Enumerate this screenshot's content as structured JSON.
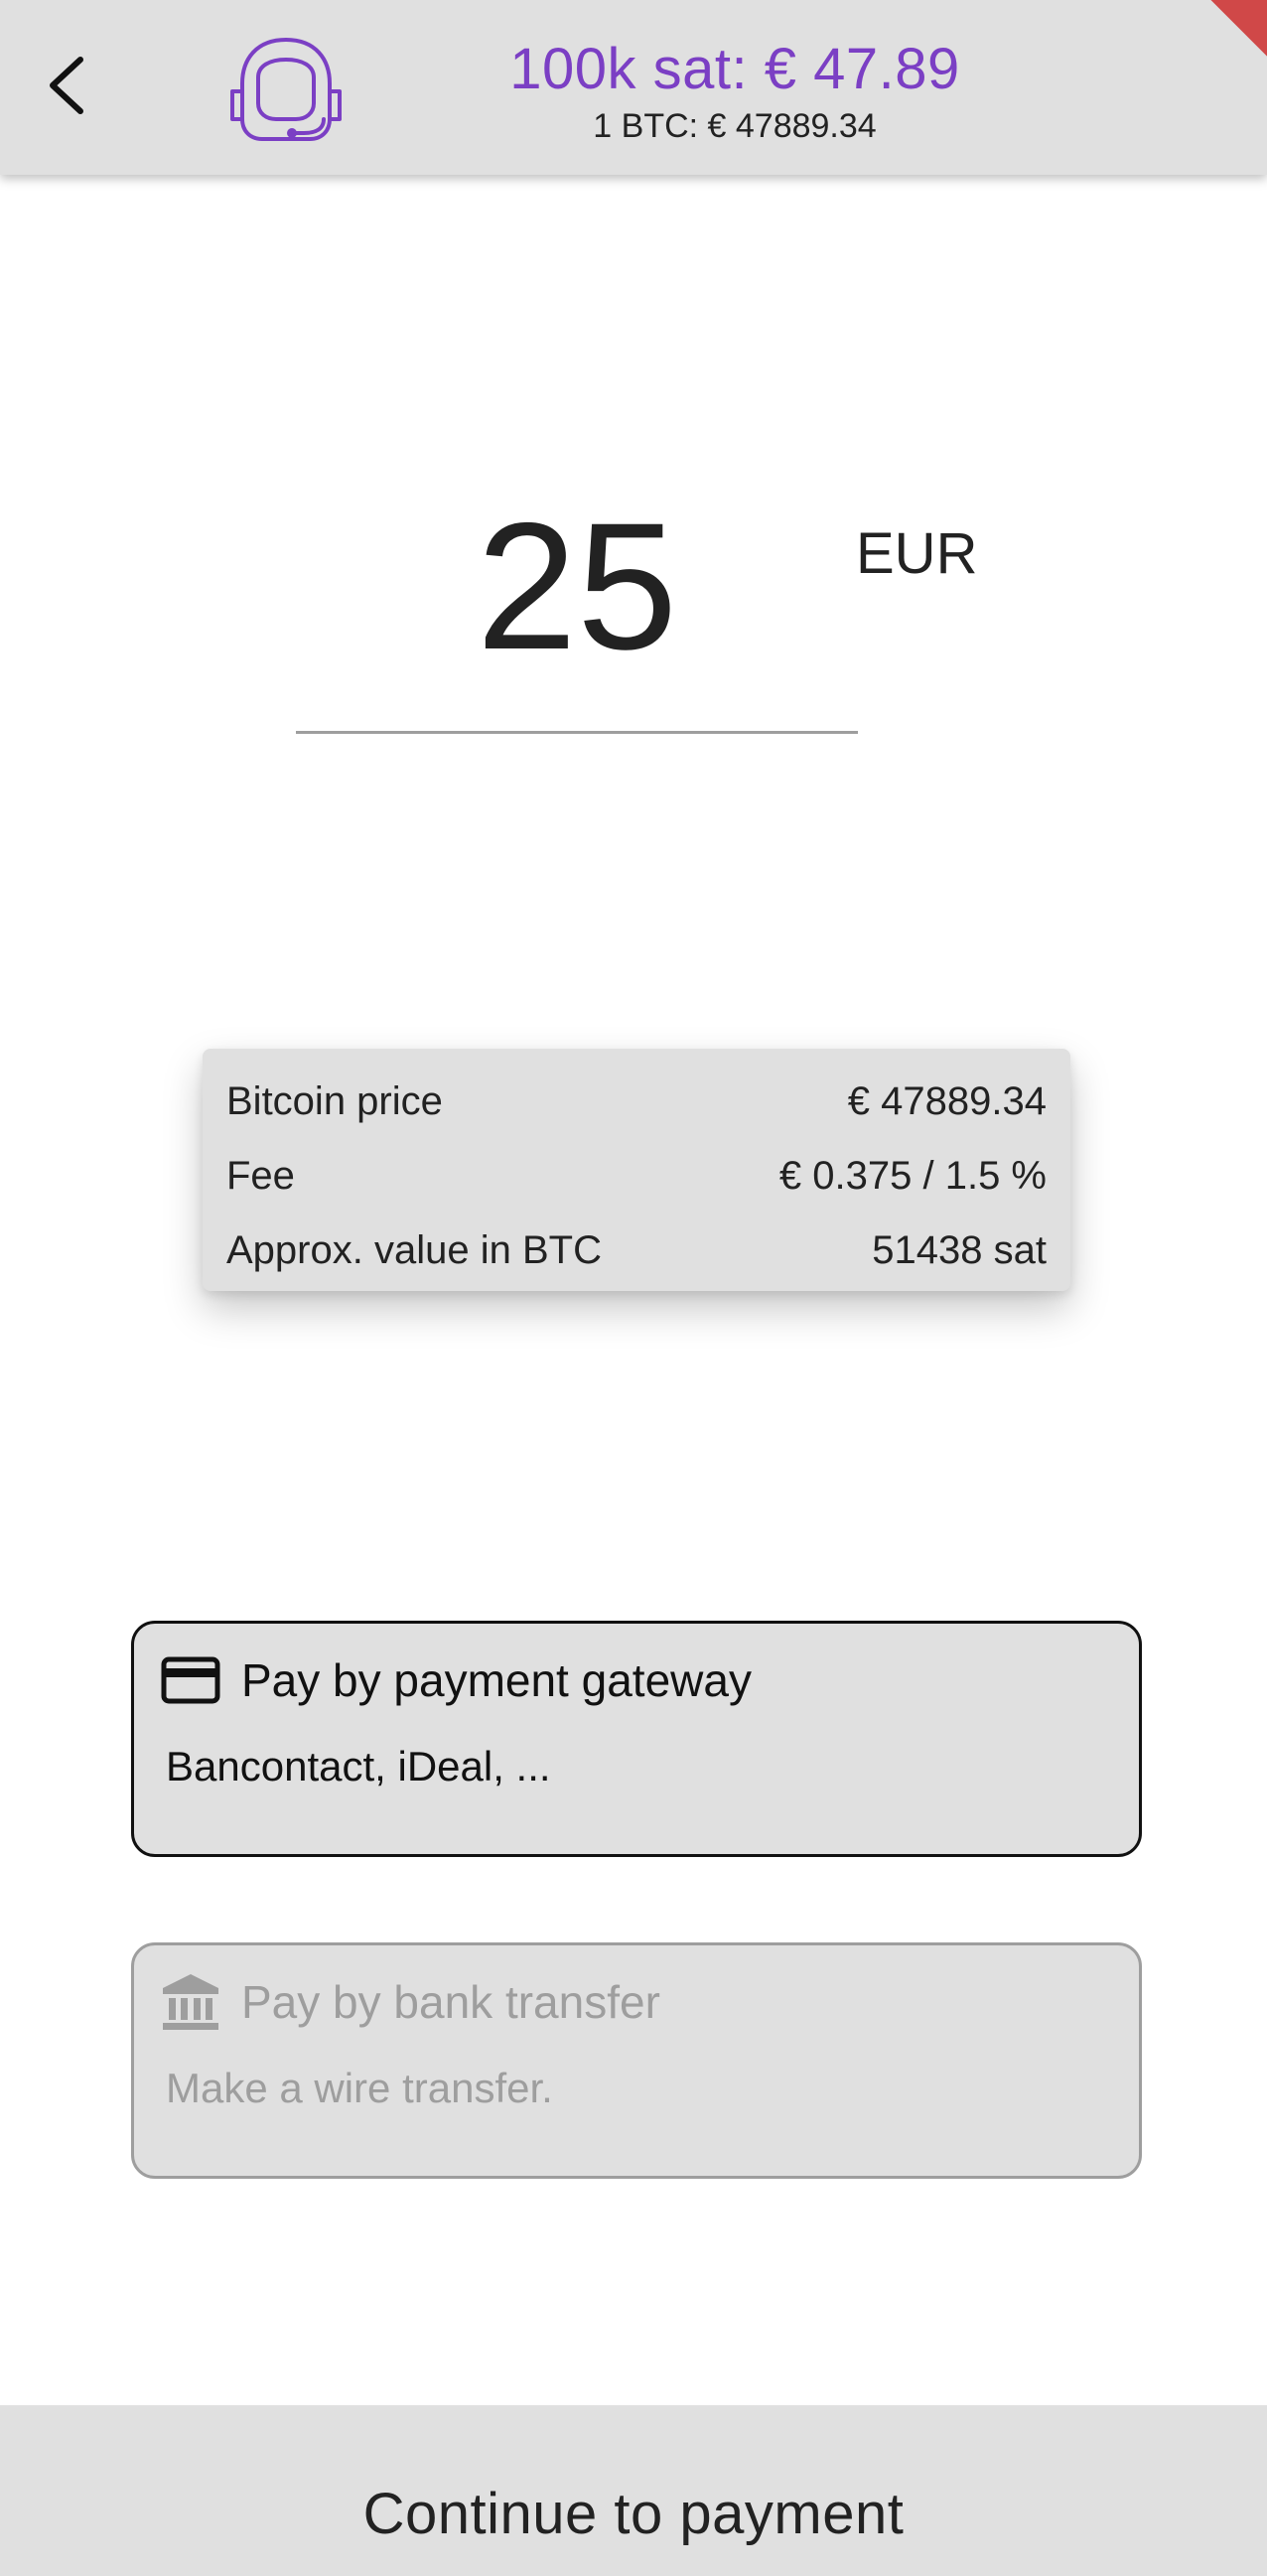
{
  "header": {
    "back_icon": "chevron-left-icon",
    "avatar_icon": "astronaut-helmet-icon",
    "price_main": "100k sat: € 47.89",
    "price_sub": "1 BTC: € 47889.34",
    "accent_color": "#7b3fc4"
  },
  "amount": {
    "value": "25",
    "currency": "EUR"
  },
  "summary": {
    "rows": [
      {
        "label": "Bitcoin price",
        "value": "€ 47889.34"
      },
      {
        "label": "Fee",
        "value": "€ 0.375 / 1.5 %"
      },
      {
        "label": "Approx. value in BTC",
        "value": "51438 sat"
      }
    ]
  },
  "payment_options": [
    {
      "icon": "credit-card-icon",
      "title": "Pay by payment gateway",
      "description": "Bancontact, iDeal, ...",
      "enabled": true
    },
    {
      "icon": "bank-icon",
      "title": "Pay by bank transfer",
      "description": "Make a wire transfer.",
      "enabled": false
    }
  ],
  "footer": {
    "continue_label": "Continue to payment"
  }
}
